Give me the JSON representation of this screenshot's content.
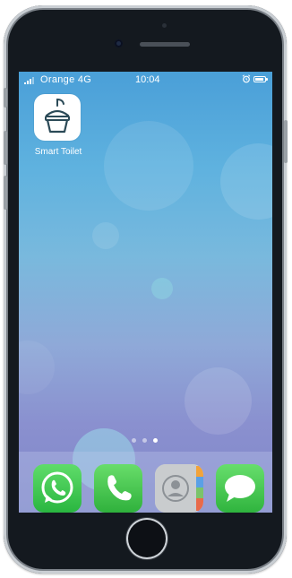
{
  "status_bar": {
    "carrier": "Orange 4G",
    "time": "10:04",
    "icons": [
      "signal-icon",
      "alarm-icon",
      "battery-icon"
    ]
  },
  "home_screen": {
    "apps": [
      {
        "label": "Smart Toilet",
        "icon": "smart-toilet-icon"
      }
    ],
    "page_count": 3,
    "active_page": 3
  },
  "dock": {
    "apps": [
      {
        "icon": "whatsapp-icon",
        "color": "#3cc44e"
      },
      {
        "icon": "phone-icon",
        "color": "#3cc44e"
      },
      {
        "icon": "contacts-icon",
        "color": "#cdd0d2"
      },
      {
        "icon": "messages-icon",
        "color": "#3cc44e"
      }
    ]
  },
  "colors": {
    "wallpaper_top": "#4a9fd8",
    "wallpaper_bottom": "#7f86c8",
    "device_frame": "#14191f"
  }
}
